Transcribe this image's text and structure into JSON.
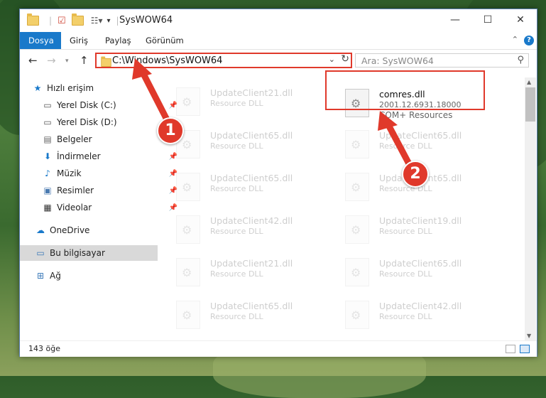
{
  "window": {
    "title": "SysWOW64"
  },
  "ribbon": {
    "tabs": [
      "Dosya",
      "Giriş",
      "Paylaş",
      "Görünüm"
    ]
  },
  "address": {
    "path": "C:\\Windows\\SysWOW64",
    "search_placeholder": "Ara: SysWOW64"
  },
  "nav": {
    "items": [
      {
        "label": "Hızlı erişim",
        "icon": "star-icon"
      },
      {
        "label": "Yerel Disk (C:)",
        "icon": "drive-icon",
        "pinned": true
      },
      {
        "label": "Yerel Disk (D:)",
        "icon": "drive-icon",
        "pinned": true
      },
      {
        "label": "Belgeler",
        "icon": "documents-icon",
        "pinned": true
      },
      {
        "label": "İndirmeler",
        "icon": "download-icon",
        "pinned": true
      },
      {
        "label": "Müzik",
        "icon": "music-icon",
        "pinned": true
      },
      {
        "label": "Resimler",
        "icon": "pictures-icon",
        "pinned": true
      },
      {
        "label": "Videolar",
        "icon": "video-icon",
        "pinned": true
      },
      {
        "label": "OneDrive",
        "icon": "cloud-icon"
      },
      {
        "label": "Bu bilgisayar",
        "icon": "computer-icon",
        "selected": true
      },
      {
        "label": "Ağ",
        "icon": "network-icon"
      }
    ]
  },
  "files": {
    "left_column": [
      {
        "name": "UpdateClient21.dll",
        "desc": "Resource DLL"
      },
      {
        "name": "UpdateClient65.dll",
        "desc": "Resource DLL"
      },
      {
        "name": "UpdateClient65.dll",
        "desc": "Resource DLL"
      },
      {
        "name": "UpdateClient42.dll",
        "desc": "Resource DLL"
      },
      {
        "name": "UpdateClient21.dll",
        "desc": "Resource DLL"
      },
      {
        "name": "UpdateClient65.dll",
        "desc": "Resource DLL"
      }
    ],
    "right_column": [
      {
        "name": "UpdateClient65.dll",
        "desc": "Resource DLL"
      },
      {
        "name": "UpdateClient65.dll",
        "desc": "Resource DLL"
      },
      {
        "name": "UpdateClient19.dll",
        "desc": "Resource DLL"
      },
      {
        "name": "UpdateClient65.dll",
        "desc": "Resource DLL"
      },
      {
        "name": "UpdateClient42.dll",
        "desc": "Resource DLL"
      }
    ],
    "highlighted": {
      "name": "comres.dll",
      "version": "2001.12.6931.18000",
      "desc": "COM+ Resources"
    }
  },
  "status": {
    "count": "143 öğe"
  },
  "callouts": [
    "1",
    "2"
  ],
  "colors": {
    "accent": "#1979ca",
    "callout": "#e0392b"
  }
}
